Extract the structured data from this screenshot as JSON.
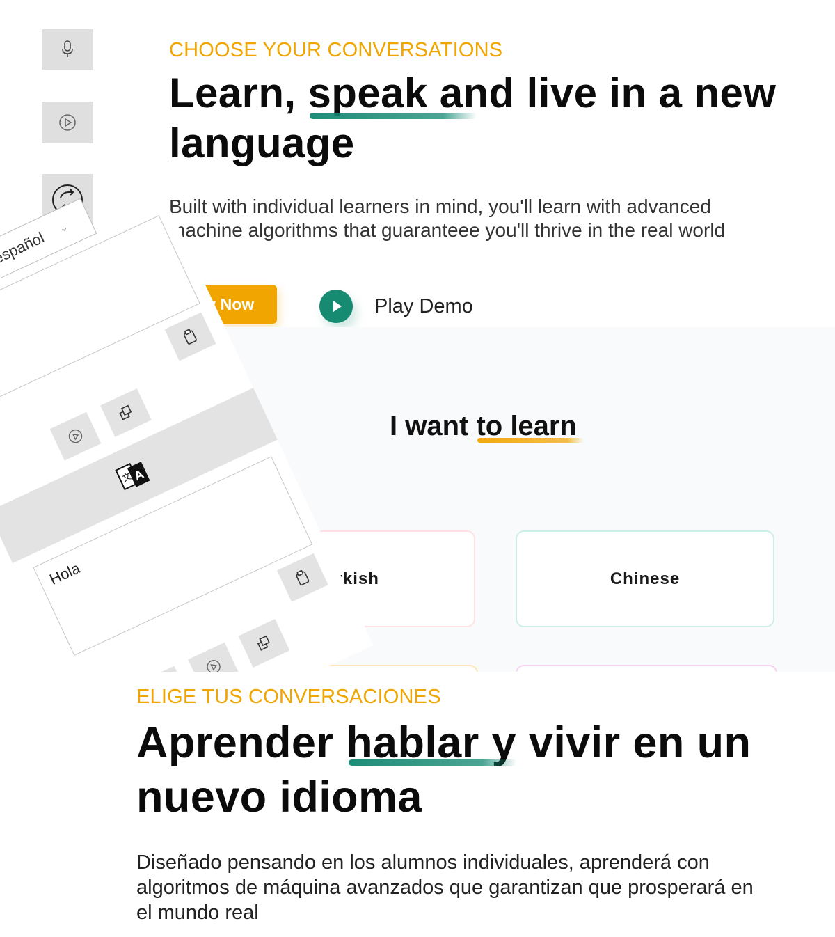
{
  "hero": {
    "eyebrow": "CHOOSE YOUR CONVERSATIONS",
    "title_line1_a": "Learn, ",
    "title_line1_b": "speak",
    "title_line1_c": " and live in a new",
    "title_line2": "language",
    "subtitle_line1": "Built with individual learners in mind, you'll learn with advanced",
    "subtitle_line2": "machine algorithms that guaranteee you'll thrive in the real world",
    "try_button": "Try Now",
    "play_label": "Play Demo"
  },
  "learn": {
    "title_a": "I want ",
    "title_b": "to learn",
    "cards": [
      "Turkish",
      "Chinese"
    ]
  },
  "spanish": {
    "eyebrow": "ELIGE TUS CONVERSACIONES",
    "title_line1_a": "Aprender ",
    "title_line1_b": "hablar y",
    "title_line1_c": " vivir en un",
    "title_line2": "nuevo idioma",
    "subtitle_line1": "Diseñado pensando en los alumnos individuales, aprenderá con",
    "subtitle_line2": "algoritmos de máquina avanzados que garantizan que prosperará en",
    "subtitle_line3": "el mundo real"
  },
  "widget": {
    "language_select": "español",
    "output_text": "Hola",
    "icons": [
      "microphone-icon",
      "play-icon",
      "swap-icon",
      "clipboard-icon",
      "copy-icon",
      "translate-icon"
    ]
  },
  "colors": {
    "accent": "#f0a500",
    "teal": "#178a72",
    "panel": "#f9fafc",
    "gray_button": "#dfdfdf"
  }
}
